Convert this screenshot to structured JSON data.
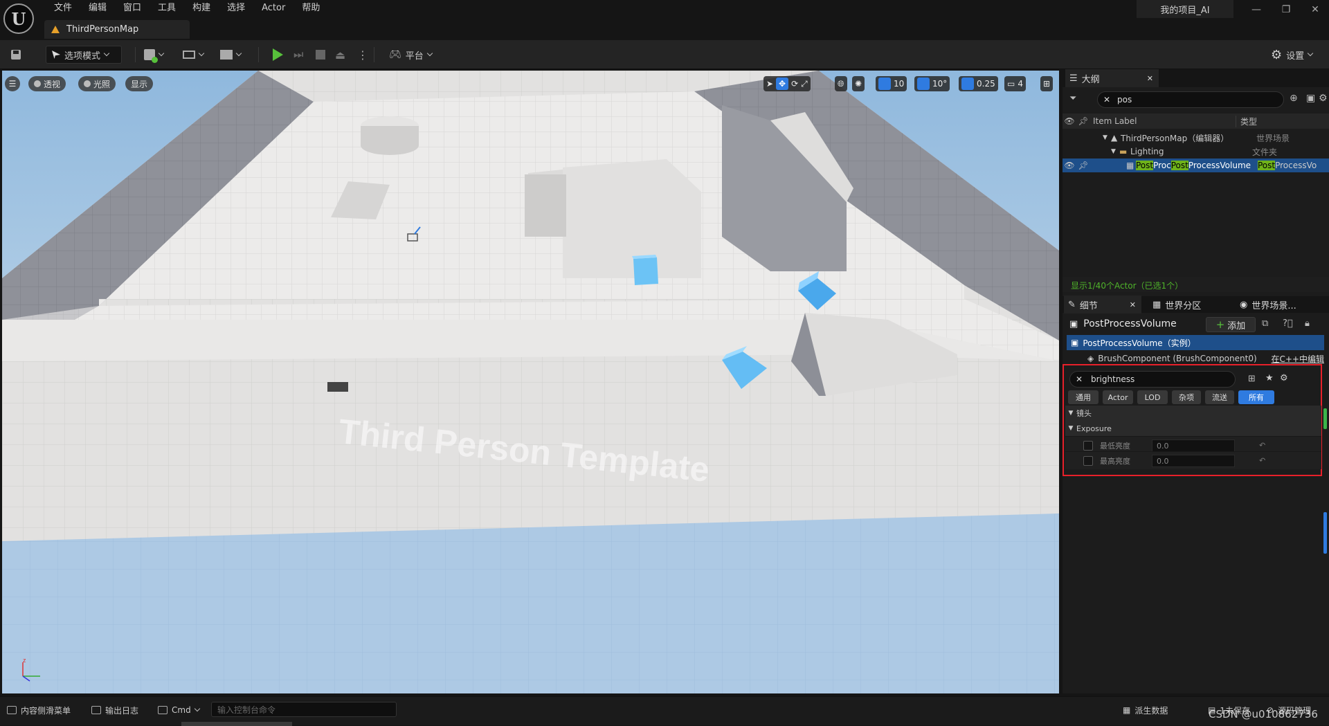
{
  "menu": [
    "文件",
    "编辑",
    "窗口",
    "工具",
    "构建",
    "选择",
    "Actor",
    "帮助"
  ],
  "doc_tab": "ThirdPersonMap",
  "project_name": "我的项目_AI",
  "toolbar": {
    "mode": "选项模式",
    "platform": "平台",
    "settings": "设置"
  },
  "viewport": {
    "menu_perspective": "透视",
    "menu_lighting": "光照",
    "menu_show": "显示",
    "grid_snap": "10",
    "rotate_snap": "10°",
    "scale_snap": "0.25",
    "camera_speed": "4",
    "floor_text": "Third Person Template"
  },
  "outliner": {
    "tab_title": "大纲",
    "search_value": "pos",
    "col_label": "Item Label",
    "col_type": "类型",
    "rows": [
      {
        "label": "ThirdPersonMap（编辑器）",
        "type": "世界场景"
      },
      {
        "label": "Lighting",
        "type": "文件夹"
      },
      {
        "label_parts": [
          "Post",
          "Proc",
          "Post",
          "ProcessVolume"
        ],
        "type_hl": "Post",
        "type_rest": "ProcessVo"
      }
    ],
    "status": "显示1/40个Actor（已选1个）"
  },
  "details": {
    "tab_details": "细节",
    "tab_world_partition": "世界分区",
    "tab_world_settings": "世界场景...",
    "actor_name": "PostProcessVolume",
    "add_button": "添加",
    "instance_row": "PostProcessVolume（实例）",
    "component_row": "BrushComponent (BrushComponent0)",
    "edit_cpp": "在C++中编辑",
    "search_value": "brightness",
    "filters": [
      "通用",
      "Actor",
      "LOD",
      "杂项",
      "流送",
      "所有"
    ],
    "section_lens": "镜头",
    "section_exposure": "Exposure",
    "prop_min": {
      "label": "最低亮度",
      "value": "0.0"
    },
    "prop_max": {
      "label": "最高亮度",
      "value": "0.0"
    }
  },
  "statusbar": {
    "content_drawer": "内容侧滑菜单",
    "output_log": "输出日志",
    "cmd": "Cmd",
    "console_placeholder": "输入控制台命令",
    "derived_data": "派生数据",
    "unsaved": "1未保存",
    "source_control": "源码管理",
    "watermark": "CSDN @u010862736"
  },
  "colors": {
    "accent_blue": "#2f7be0",
    "play_green": "#57c13b",
    "highlight_green": "#6fb31a",
    "annotation_red": "#e8202a"
  }
}
